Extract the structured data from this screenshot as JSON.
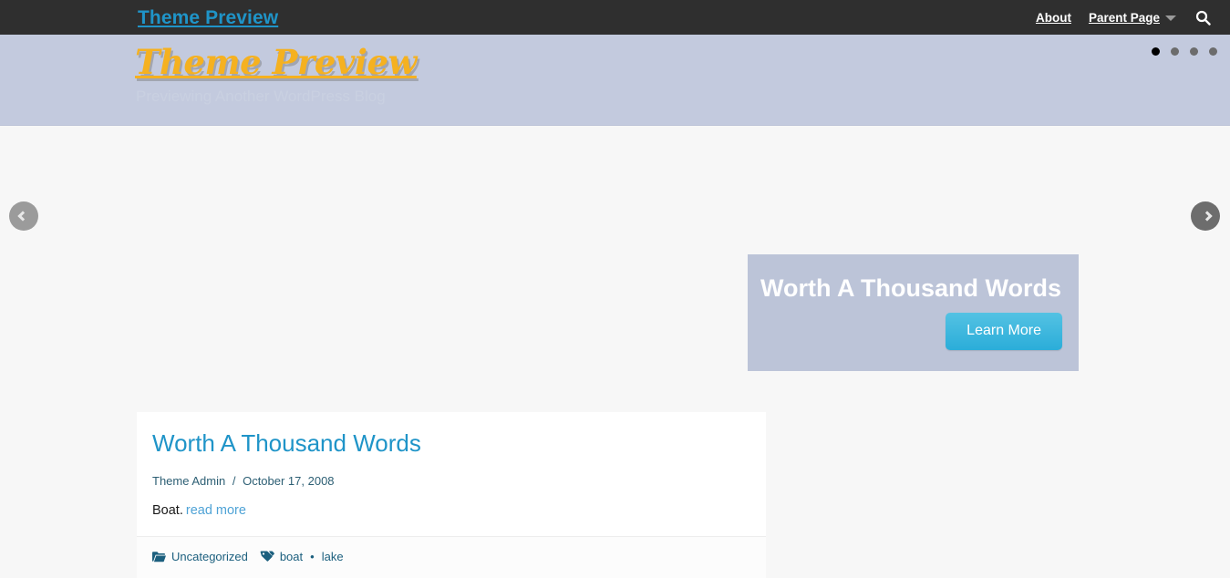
{
  "topbar": {
    "brand": "Theme Preview",
    "nav": [
      {
        "label": "About",
        "has_dropdown": false
      },
      {
        "label": "Parent Page",
        "has_dropdown": true
      }
    ],
    "search_icon": "search-icon",
    "background_color": "#2f2f2f",
    "brand_color": "#1f94c8"
  },
  "header": {
    "logo_text": "Theme Preview",
    "tagline": "Previewing Another WordPress Blog",
    "logo_color": "#f5b120",
    "band_color": "#c3cade",
    "slider_dots": {
      "count": 4,
      "active_index": 0
    }
  },
  "hero": {
    "prev_arrow_icon": "chevron-left-icon",
    "next_arrow_icon": "chevron-right-icon",
    "caption": {
      "title": "Worth A Thousand Words",
      "button_label": "Learn More",
      "button_color": "#2badd9",
      "box_color": "#bcc4d8"
    }
  },
  "post": {
    "title": "Worth A Thousand Words",
    "author": "Theme Admin",
    "meta_separator": "/",
    "date": "October 17, 2008",
    "excerpt": "Boat.",
    "read_more_label": "read more",
    "category_icon": "folder-open-icon",
    "category": "Uncategorized",
    "tag_icon": "tag-icon",
    "tags": [
      "boat",
      "lake"
    ],
    "tag_separator": "•",
    "title_color": "#1f94c8"
  }
}
